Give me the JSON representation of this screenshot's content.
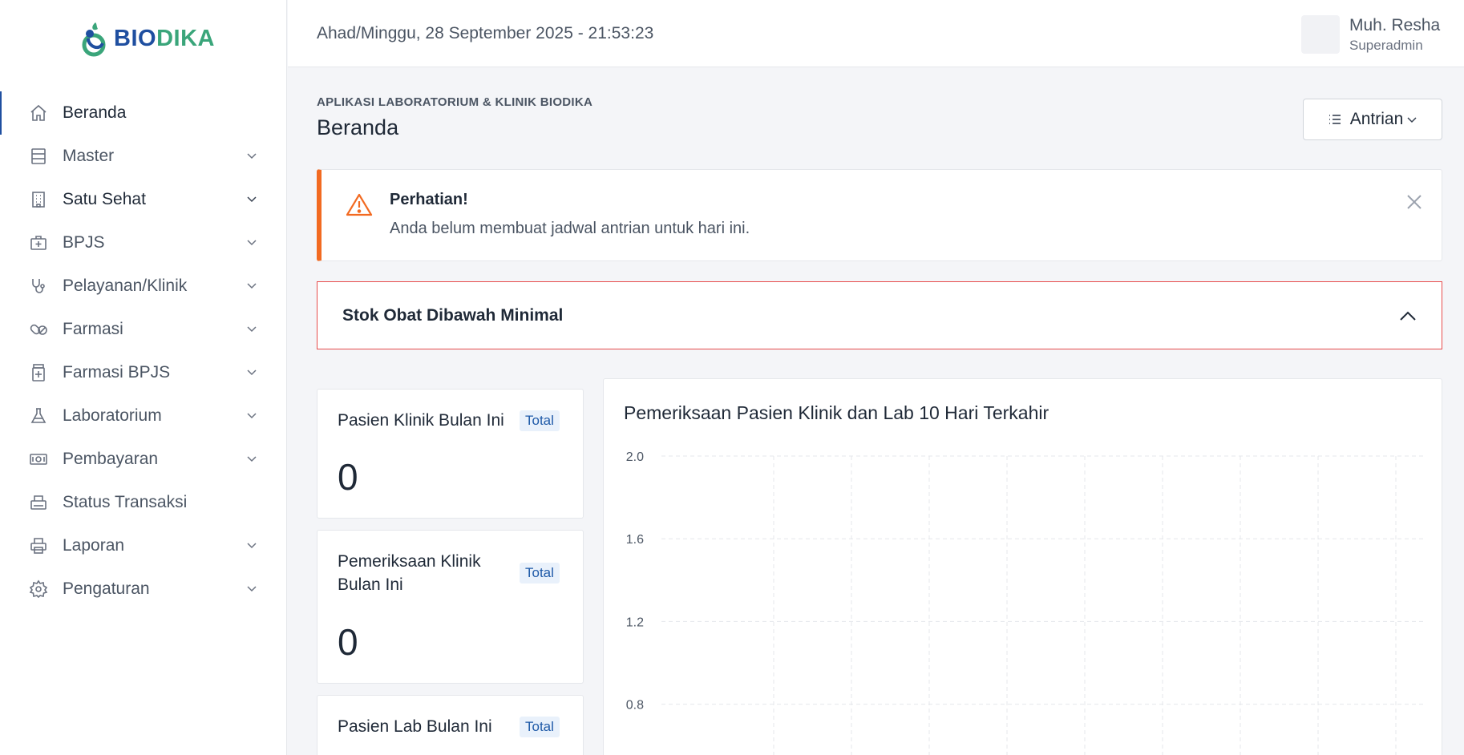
{
  "brand": {
    "part1": "BIO",
    "part2": "DIKA"
  },
  "sidebar": {
    "items": [
      {
        "label": "Beranda",
        "icon": "home-icon",
        "chevron": false,
        "active": true
      },
      {
        "label": "Master",
        "icon": "database-icon",
        "chevron": true
      },
      {
        "label": "Satu Sehat",
        "icon": "building-icon",
        "chevron": true
      },
      {
        "label": "BPJS",
        "icon": "medical-kit-icon",
        "chevron": true
      },
      {
        "label": "Pelayanan/Klinik",
        "icon": "stethoscope-icon",
        "chevron": true
      },
      {
        "label": "Farmasi",
        "icon": "pills-icon",
        "chevron": true
      },
      {
        "label": "Farmasi BPJS",
        "icon": "medicine-bottle-icon",
        "chevron": true
      },
      {
        "label": "Laboratorium",
        "icon": "flask-icon",
        "chevron": true
      },
      {
        "label": "Pembayaran",
        "icon": "cash-icon",
        "chevron": true
      },
      {
        "label": "Status Transaksi",
        "icon": "printer-receipt-icon",
        "chevron": false
      },
      {
        "label": "Laporan",
        "icon": "printer-icon",
        "chevron": true
      },
      {
        "label": "Pengaturan",
        "icon": "gear-icon",
        "chevron": true
      }
    ]
  },
  "header": {
    "datetime": "Ahad/Minggu, 28 September 2025 - 21:53:23",
    "user_name": "Muh. Resha",
    "user_role": "Superadmin"
  },
  "page": {
    "kicker": "APLIKASI LABORATORIUM & KLINIK BIODIKA",
    "title": "Beranda",
    "antrian_label": "Antrian"
  },
  "alert": {
    "title": "Perhatian!",
    "message": "Anda belum membuat jadwal antrian untuk hari ini."
  },
  "stok": {
    "title": "Stok Obat Dibawah Minimal"
  },
  "cards": [
    {
      "title": "Pasien Klinik Bulan Ini",
      "badge": "Total",
      "value": "0"
    },
    {
      "title": "Pemeriksaan Klinik Bulan Ini",
      "badge": "Total",
      "value": "0"
    },
    {
      "title": "Pasien Lab Bulan Ini",
      "badge": "Total",
      "value": ""
    }
  ],
  "colors": {
    "brand_blue": "#1f4fa0",
    "brand_green": "#3aa57a",
    "alert_orange": "#f26a21",
    "danger_border": "#e74c4c",
    "badge_text": "#1f5aa8"
  },
  "chart_data": {
    "type": "line",
    "title": "Pemeriksaan Pasien Klinik dan Lab 10 Hari Terkahir",
    "yticks": [
      2.0,
      1.6,
      1.2,
      0.8
    ],
    "ylim": [
      0.8,
      2.0
    ],
    "grid": true,
    "series": []
  }
}
